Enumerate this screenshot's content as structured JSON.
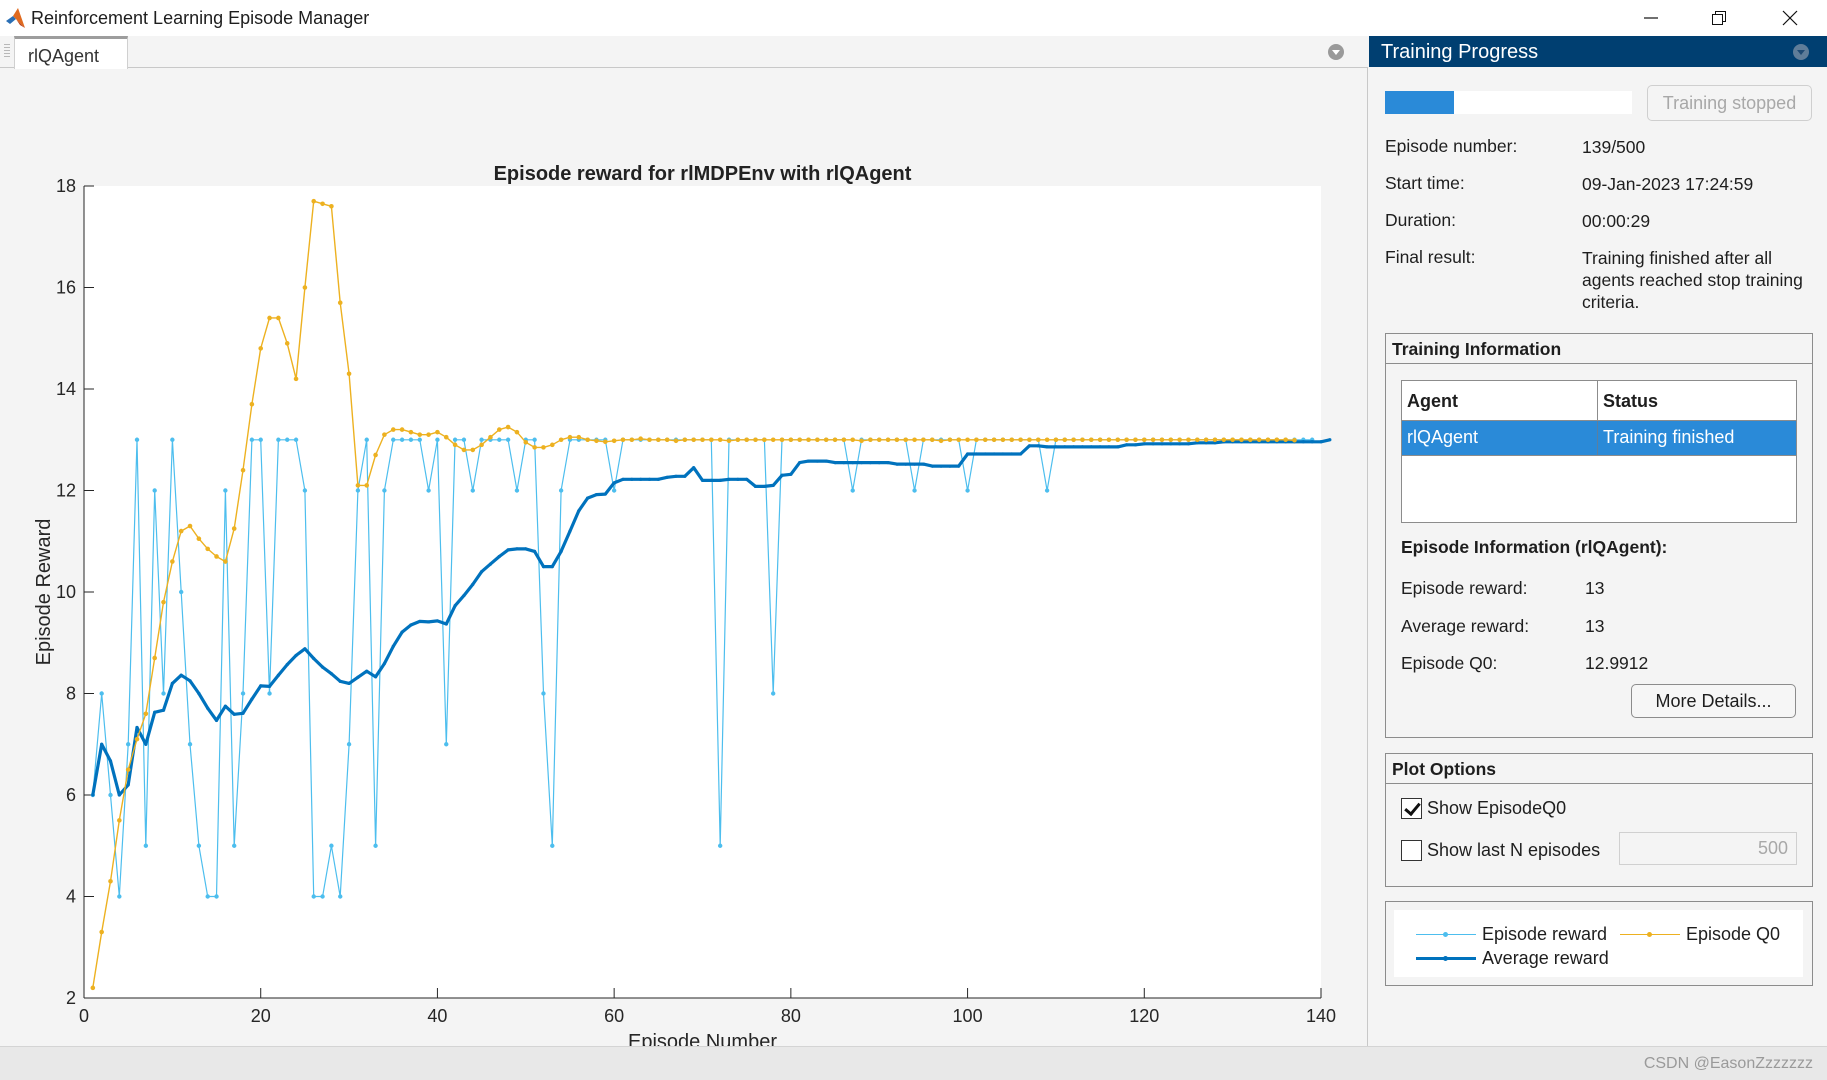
{
  "window": {
    "title": "Reinforcement Learning Episode Manager",
    "controls": [
      "minimize",
      "restore",
      "close"
    ]
  },
  "document_tabs": [
    {
      "label": "rlQAgent",
      "active": true
    }
  ],
  "watermark": "CSDN @EasonZzzzzzz",
  "panel": {
    "title": "Training Progress",
    "progress_fraction": 0.278,
    "stop_button": "Training stopped",
    "fields": [
      {
        "label": "Episode number:",
        "value": "139/500"
      },
      {
        "label": "Start time:",
        "value": "09-Jan-2023 17:24:59"
      },
      {
        "label": "Duration:",
        "value": "00:00:29"
      },
      {
        "label": "Final result:",
        "value": "Training finished after all agents reached stop training criteria."
      }
    ],
    "training_info": {
      "title": "Training Information",
      "columns": [
        "Agent",
        "Status"
      ],
      "rows": [
        {
          "agent": "rlQAgent",
          "status": "Training finished",
          "selected": true
        }
      ]
    },
    "episode_info": {
      "title": "Episode Information (rlQAgent):",
      "fields": [
        {
          "label": "Episode reward:",
          "value": "13"
        },
        {
          "label": "Average reward:",
          "value": "13"
        },
        {
          "label": "Episode Q0:",
          "value": "12.9912"
        }
      ],
      "more_button": "More Details..."
    },
    "plot_options": {
      "title": "Plot Options",
      "show_q0": {
        "label": "Show EpisodeQ0",
        "checked": true
      },
      "show_last_n": {
        "label": "Show last N episodes",
        "checked": false,
        "value": "500"
      }
    },
    "legend": [
      {
        "label": "Episode reward",
        "color": "#4dbeee"
      },
      {
        "label": "Episode Q0",
        "color": "#edb120"
      },
      {
        "label": "Average reward",
        "color": "#0072bd"
      }
    ]
  },
  "chart_data": {
    "type": "line",
    "title": "Episode reward for rlMDPEnv with rlQAgent",
    "xlabel": "Episode Number",
    "ylabel": "Episode Reward",
    "xlim": [
      0,
      140
    ],
    "ylim": [
      2,
      18
    ],
    "xticks": [
      0,
      20,
      40,
      60,
      80,
      100,
      120,
      140
    ],
    "yticks": [
      2,
      4,
      6,
      8,
      10,
      12,
      14,
      16,
      18
    ],
    "grid": false,
    "series": [
      {
        "name": "Episode reward",
        "color": "#4dbeee",
        "values": [
          6,
          8,
          6,
          4,
          7,
          13,
          5,
          12,
          8,
          13,
          10,
          7,
          5,
          4,
          4,
          12,
          5,
          8,
          13,
          13,
          8,
          13,
          13,
          13,
          12,
          4,
          4,
          5,
          4,
          7,
          12,
          13,
          5,
          12,
          13,
          13,
          13,
          13,
          12,
          13,
          7,
          13,
          13,
          12,
          13,
          13,
          13,
          13,
          12,
          13,
          13,
          8,
          5,
          12,
          13,
          13,
          13,
          13,
          13,
          12,
          13,
          13,
          13,
          13,
          13,
          13,
          13,
          13,
          13,
          13,
          13,
          5,
          13,
          13,
          13,
          13,
          13,
          8,
          13,
          13,
          13,
          13,
          13,
          13,
          13,
          13,
          12,
          13,
          13,
          13,
          13,
          13,
          13,
          12,
          13,
          13,
          13,
          13,
          13,
          12,
          13,
          13,
          13,
          13,
          13,
          13,
          13,
          13,
          12,
          13,
          13,
          13,
          13,
          13,
          13,
          13,
          13,
          13,
          13,
          13,
          13,
          13,
          13,
          13,
          13,
          13,
          13,
          13,
          13,
          13,
          13,
          13,
          13,
          13,
          13,
          13,
          13,
          13,
          13
        ]
      },
      {
        "name": "Episode Q0",
        "color": "#edb120",
        "values": [
          2.2,
          3.3,
          4.3,
          5.5,
          6.5,
          7.1,
          7.6,
          8.7,
          9.8,
          10.6,
          11.2,
          11.3,
          11.05,
          10.85,
          10.7,
          10.6,
          11.25,
          12.4,
          13.7,
          14.8,
          15.4,
          15.4,
          14.9,
          14.2,
          16.0,
          17.7,
          17.65,
          17.6,
          15.7,
          14.3,
          12.1,
          12.1,
          12.7,
          13.1,
          13.2,
          13.2,
          13.15,
          13.1,
          13.1,
          13.15,
          13.05,
          12.9,
          12.8,
          12.8,
          12.9,
          13.05,
          13.2,
          13.25,
          13.15,
          12.95,
          12.85,
          12.85,
          12.9,
          13.0,
          13.05,
          13.05,
          13.0,
          12.98,
          12.96,
          12.98,
          13.0,
          13.0,
          13.02,
          13.0,
          13.0,
          13.0,
          12.98,
          13.0,
          13.0,
          13.0,
          13.0,
          13.0,
          12.98,
          13.0,
          13.0,
          13.0,
          13.0,
          13.0,
          13.0,
          13.0,
          13.0,
          13.0,
          13.0,
          13.0,
          13.0,
          13.0,
          13.0,
          12.98,
          13.0,
          13.0,
          13.0,
          13.0,
          13.0,
          13.0,
          13.0,
          13.0,
          12.98,
          13.0,
          13.0,
          13.0,
          13.0,
          13.0,
          13.0,
          13.0,
          13.0,
          13.0,
          13.0,
          13.0,
          13.0,
          13.0,
          13.0,
          13.0,
          13.0,
          13.0,
          13.0,
          13.0,
          13.0,
          13.0,
          13.0,
          13.0,
          13.0,
          13.0,
          13.0,
          13.0,
          13.0,
          13.0,
          13.0,
          13.0,
          13.0,
          13.0,
          13.0,
          13.0,
          13.0,
          13.0,
          13.0,
          13.0,
          12.99
        ]
      },
      {
        "name": "Average reward",
        "color": "#0072bd",
        "values": [
          6,
          7,
          6.67,
          6,
          6.2,
          7.33,
          7,
          7.63,
          7.67,
          8.2,
          8.36,
          8.25,
          8.0,
          7.71,
          7.47,
          7.75,
          7.59,
          7.61,
          7.89,
          8.15,
          8.14,
          8.36,
          8.57,
          8.75,
          8.88,
          8.69,
          8.52,
          8.39,
          8.24,
          8.2,
          8.32,
          8.44,
          8.33,
          8.59,
          8.93,
          9.21,
          9.35,
          9.42,
          9.41,
          9.43,
          9.37,
          9.73,
          9.93,
          10.15,
          10.4,
          10.55,
          10.7,
          10.83,
          10.85,
          10.85,
          10.8,
          10.5,
          10.5,
          10.8,
          11.2,
          11.6,
          11.85,
          11.92,
          11.93,
          12.15,
          12.22,
          12.22,
          12.22,
          12.22,
          12.22,
          12.26,
          12.28,
          12.28,
          12.45,
          12.2,
          12.2,
          12.2,
          12.22,
          12.22,
          12.22,
          12.08,
          12.08,
          12.1,
          12.3,
          12.32,
          12.55,
          12.58,
          12.58,
          12.58,
          12.55,
          12.55,
          12.55,
          12.55,
          12.55,
          12.55,
          12.55,
          12.52,
          12.52,
          12.52,
          12.52,
          12.48,
          12.48,
          12.48,
          12.48,
          12.72,
          12.72,
          12.72,
          12.72,
          12.72,
          12.72,
          12.72,
          12.88,
          12.88,
          12.86,
          12.86,
          12.86,
          12.86,
          12.86,
          12.86,
          12.86,
          12.86,
          12.86,
          12.9,
          12.9,
          12.92,
          12.92,
          12.92,
          12.92,
          12.92,
          12.92,
          12.94,
          12.94,
          12.94,
          12.96,
          12.96,
          12.96,
          12.96,
          12.96,
          12.96,
          12.96,
          12.96,
          12.96,
          12.96,
          12.96,
          12.96,
          13.0
        ]
      }
    ]
  }
}
